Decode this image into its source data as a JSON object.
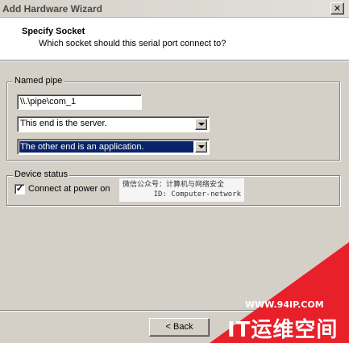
{
  "window": {
    "title": "Add Hardware Wizard",
    "close_glyph": "✕"
  },
  "header": {
    "heading": "Specify Socket",
    "subheading": "Which socket should this serial port connect to?"
  },
  "named_pipe": {
    "legend": "Named pipe",
    "pipe_value": "\\\\.\\pipe\\com_1",
    "end_select": {
      "selected": "This end is the server."
    },
    "other_end_select": {
      "selected": "The other end is an application."
    }
  },
  "device_status": {
    "legend": "Device status",
    "checkbox_checked": true,
    "checkbox_glyph": "✓",
    "checkbox_label": "Connect at power on"
  },
  "buttons": {
    "back_label": "< Back"
  },
  "watermarks": {
    "wechat_line1": "微信公众号：计算机与网络安全",
    "wechat_line2": "ID: Computer-network",
    "site_url": "WWW.94IP.COM",
    "site_name": "IT运维空间"
  },
  "colors": {
    "dialog_bg": "#d4d0c8",
    "selection_bg": "#0a246a",
    "brand_red": "#e8202a"
  },
  "icons": {
    "close": "close-icon",
    "dropdown": "chevron-down-icon",
    "check": "checkmark-icon"
  }
}
